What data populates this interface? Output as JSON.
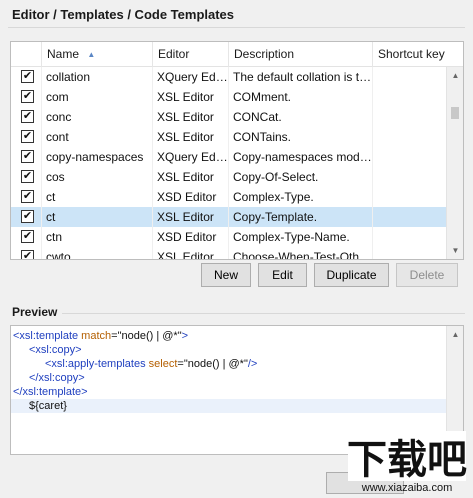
{
  "page": {
    "title": "Editor / Templates / Code Templates"
  },
  "table": {
    "columns": [
      "Name",
      "Editor",
      "Description",
      "Shortcut key"
    ],
    "sort_indicator": "▲",
    "rows": [
      {
        "name": "collation",
        "editor": "XQuery Editor",
        "description": "The default collation is the ...",
        "shortcut": "",
        "checked": true,
        "selected": false
      },
      {
        "name": "com",
        "editor": "XSL Editor",
        "description": "COMment.",
        "shortcut": "",
        "checked": true,
        "selected": false
      },
      {
        "name": "conc",
        "editor": "XSL Editor",
        "description": "CONCat.",
        "shortcut": "",
        "checked": true,
        "selected": false
      },
      {
        "name": "cont",
        "editor": "XSL Editor",
        "description": "CONTains.",
        "shortcut": "",
        "checked": true,
        "selected": false
      },
      {
        "name": "copy-namespaces",
        "editor": "XQuery Editor",
        "description": "Copy-namespaces mode c...",
        "shortcut": "",
        "checked": true,
        "selected": false
      },
      {
        "name": "cos",
        "editor": "XSL Editor",
        "description": "Copy-Of-Select.",
        "shortcut": "",
        "checked": true,
        "selected": false
      },
      {
        "name": "ct",
        "editor": "XSD Editor",
        "description": "Complex-Type.",
        "shortcut": "",
        "checked": true,
        "selected": false
      },
      {
        "name": "ct",
        "editor": "XSL Editor",
        "description": "Copy-Template.",
        "shortcut": "",
        "checked": true,
        "selected": true
      },
      {
        "name": "ctn",
        "editor": "XSD Editor",
        "description": "Complex-Type-Name.",
        "shortcut": "",
        "checked": true,
        "selected": false
      },
      {
        "name": "cwto",
        "editor": "XSL Editor",
        "description": "Choose-When-Test-Other...",
        "shortcut": "",
        "checked": true,
        "selected": false
      }
    ]
  },
  "buttons": {
    "new": "New",
    "edit": "Edit",
    "duplicate": "Duplicate",
    "delete": "Delete"
  },
  "preview": {
    "title": "Preview",
    "lines": [
      {
        "indent": 0,
        "parts": [
          [
            "tag",
            "<xsl:template "
          ],
          [
            "attr",
            "match"
          ],
          [
            "val",
            "=\""
          ],
          [
            "val",
            "node() | @*"
          ],
          [
            "val",
            "\""
          ],
          [
            "tag",
            ">"
          ]
        ]
      },
      {
        "indent": 1,
        "parts": [
          [
            "tag",
            "<xsl:copy>"
          ]
        ]
      },
      {
        "indent": 2,
        "parts": [
          [
            "tag",
            "<xsl:apply-templates "
          ],
          [
            "attr",
            "select"
          ],
          [
            "val",
            "=\""
          ],
          [
            "val",
            "node() | @*"
          ],
          [
            "val",
            "\""
          ],
          [
            "tag",
            "/>"
          ]
        ]
      },
      {
        "indent": 1,
        "parts": [
          [
            "tag",
            "</xsl:copy>"
          ]
        ]
      },
      {
        "indent": 0,
        "parts": [
          [
            "tag",
            "</xsl:template>"
          ]
        ]
      },
      {
        "indent": 1,
        "parts": [
          [
            "val",
            "${caret}"
          ]
        ],
        "caret": true
      }
    ]
  },
  "watermark": {
    "brand": "下载吧",
    "url": "www.xiazaiba.com"
  },
  "colors": {
    "selected_row": "#cce4f7",
    "tag": "#1f3fbf",
    "attr": "#b45f00"
  }
}
